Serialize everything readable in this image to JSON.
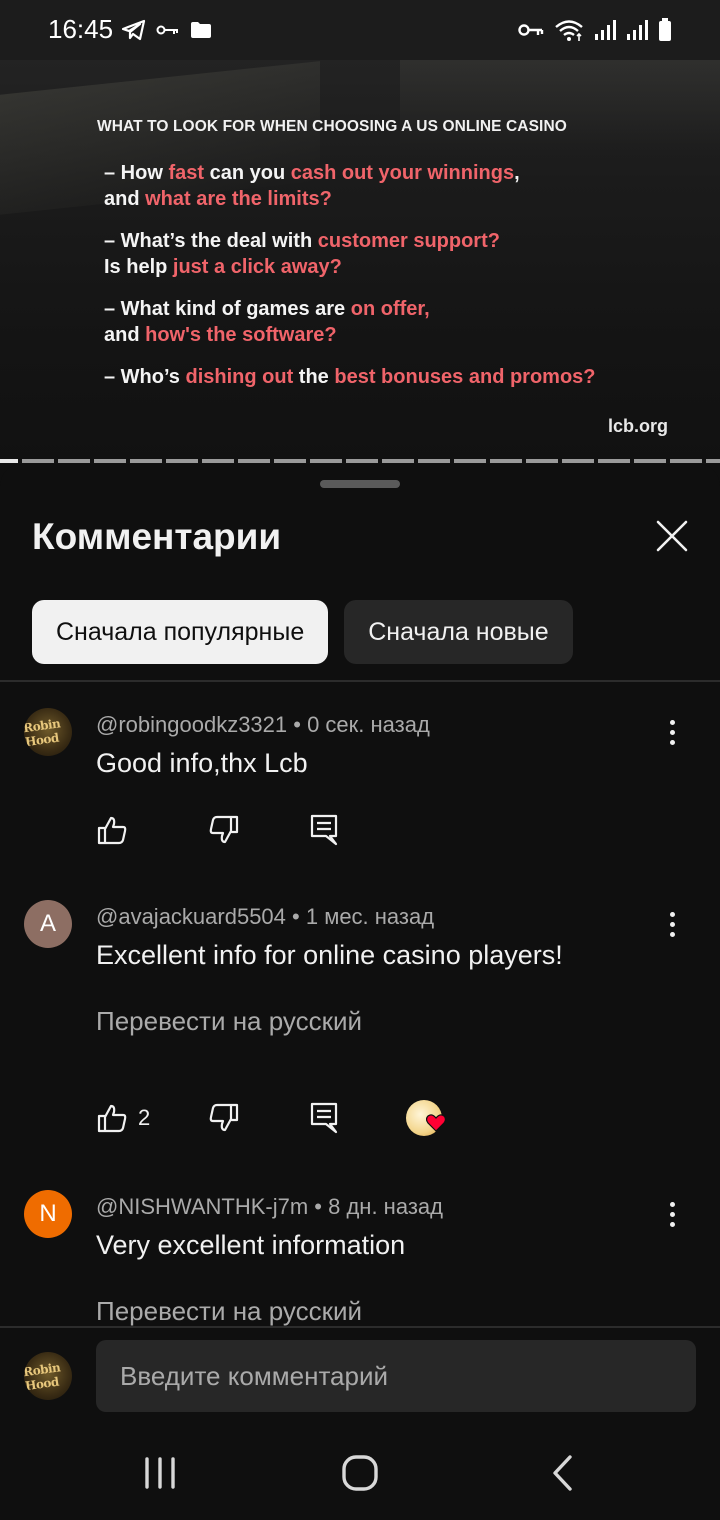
{
  "status_bar": {
    "time": "16:45",
    "left_icons": [
      "telegram-icon",
      "key-icon",
      "folder-icon"
    ],
    "right_icons": [
      "vpn-key-icon",
      "wifi-icon",
      "signal-1-icon",
      "signal-2-icon",
      "battery-icon"
    ]
  },
  "video": {
    "heading": "WHAT TO LOOK FOR WHEN CHOOSING A US ONLINE CASINO",
    "q1": {
      "a": "– How ",
      "b": "fast",
      "c": " can you ",
      "d": "cash out your winnings",
      "e": ",",
      "f": "and ",
      "g": "what are the limits?"
    },
    "q2": {
      "a": "– What’s the deal with ",
      "b": "customer support?",
      "c": "Is help ",
      "d": "just a click away?"
    },
    "q3": {
      "a": "– What kind of games are ",
      "b": "on offer,",
      "c": "and ",
      "d": "how's the software?"
    },
    "q4": {
      "a": "– Who’s ",
      "b": "dishing out",
      "c": " the ",
      "d": "best bonuses and promos?"
    },
    "brand": "lcb.org",
    "highlight_color": "#f0646a"
  },
  "sheet": {
    "title": "Комментарии",
    "close_icon": "close-icon",
    "sort_chips": {
      "popular": "Сначала популярные",
      "newest": "Сначала новые"
    }
  },
  "comments": [
    {
      "author": "@robingoodkz3321",
      "time": "0 сек. назад",
      "text": "Good info,thx Lcb",
      "avatar": "Robin Hood"
    },
    {
      "author": "@avajackuard5504",
      "time": "1 мес. назад",
      "text": "Excellent info for online casino players!",
      "avatar_letter": "A",
      "avatar_color": "#8d6e63",
      "translate": "Перевести на русский",
      "likes": "2"
    },
    {
      "author": "@NISHWANTHK-j7m",
      "time": "8 дн. назад",
      "text": "Very excellent information",
      "avatar_letter": "N",
      "avatar_color": "#ef6c00",
      "translate": "Перевести на русский"
    }
  ],
  "composer": {
    "placeholder": "Введите комментарий"
  },
  "nav": {
    "recents": "recents-icon",
    "home": "home-icon",
    "back": "back-icon"
  }
}
